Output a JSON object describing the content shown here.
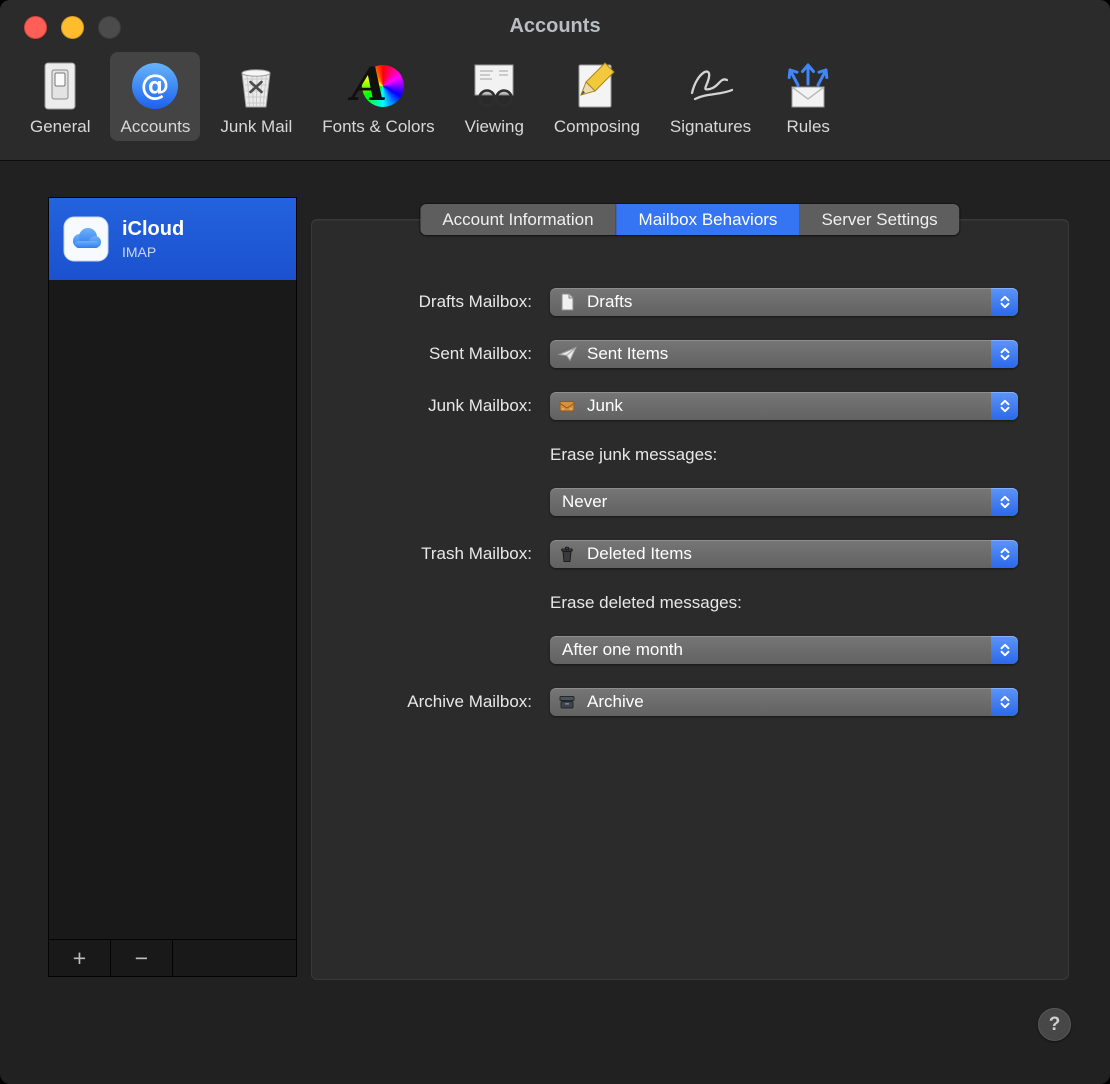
{
  "window": {
    "title": "Accounts"
  },
  "toolbar": {
    "items": [
      {
        "label": "General"
      },
      {
        "label": "Accounts"
      },
      {
        "label": "Junk Mail"
      },
      {
        "label": "Fonts & Colors"
      },
      {
        "label": "Viewing"
      },
      {
        "label": "Composing"
      },
      {
        "label": "Signatures"
      },
      {
        "label": "Rules"
      }
    ],
    "selected": "Accounts"
  },
  "sidebar": {
    "accounts": [
      {
        "name": "iCloud",
        "protocol": "IMAP",
        "selected": true
      }
    ],
    "add_button": "+",
    "remove_button": "−"
  },
  "tabs": {
    "items": [
      {
        "label": "Account Information",
        "selected": false
      },
      {
        "label": "Mailbox Behaviors",
        "selected": true
      },
      {
        "label": "Server Settings",
        "selected": false
      }
    ]
  },
  "form": {
    "drafts": {
      "label": "Drafts Mailbox:",
      "value": "Drafts",
      "icon": "drafts-document-icon"
    },
    "sent": {
      "label": "Sent Mailbox:",
      "value": "Sent Items",
      "icon": "paper-plane-icon"
    },
    "junk": {
      "label": "Junk Mailbox:",
      "value": "Junk",
      "icon": "junk-envelope-icon"
    },
    "erase_junk": {
      "label": "Erase junk messages:",
      "value": "Never"
    },
    "trash": {
      "label": "Trash Mailbox:",
      "value": "Deleted Items",
      "icon": "trash-can-icon"
    },
    "erase_deleted": {
      "label": "Erase deleted messages:",
      "value": "After one month"
    },
    "archive": {
      "label": "Archive Mailbox:",
      "value": "Archive",
      "icon": "archive-box-icon"
    }
  },
  "help": {
    "label": "?"
  },
  "colors": {
    "accent_blue": "#3574f2",
    "selection_blue": "#1e57d2",
    "popup_gray": "#6b6b6b",
    "traffic_red": "#ff5f57",
    "traffic_yellow": "#febc2e",
    "traffic_disabled": "#4b4b4b",
    "window_bg": "#212121",
    "chrome_bg": "#2b2b2b"
  }
}
